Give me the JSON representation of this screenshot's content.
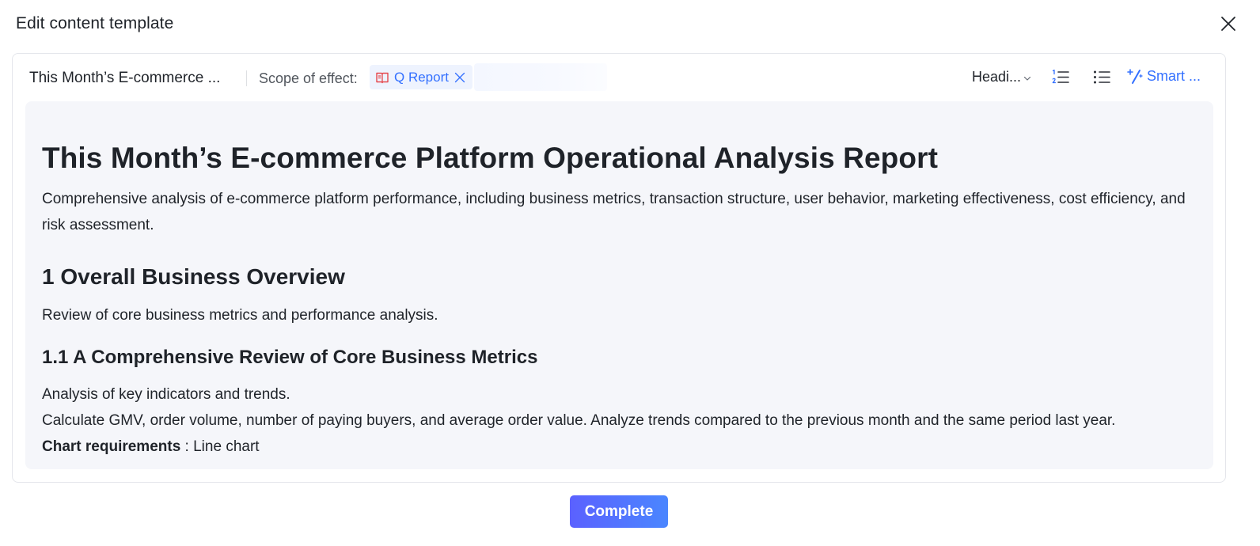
{
  "dialog": {
    "title": "Edit content template",
    "close_icon": "close-icon"
  },
  "toolbar": {
    "doc_name": "This Month’s E-commerce ...",
    "scope_label": "Scope of effect:",
    "scope_tag": {
      "label": "Q Report",
      "icon": "report-book-icon",
      "remove_icon": "close-icon"
    },
    "scope_input_placeholder": "",
    "heading_select": "Headi...",
    "ordered_list_icon": "ordered-list-icon",
    "bullet_list_icon": "bullet-list-icon",
    "smart_label": "Smart ...",
    "smart_icon": "magic-wand-icon"
  },
  "document": {
    "title": "This Month’s E-commerce Platform Operational Analysis Report",
    "intro": "Comprehensive analysis of e-commerce platform performance, including business metrics, transaction structure, user behavior, marketing effectiveness, cost efficiency, and risk assessment.",
    "section1": {
      "heading": "1 Overall Business Overview",
      "text": "Review of core business metrics and performance analysis."
    },
    "section1_1": {
      "heading": "1.1 A Comprehensive Review of Core Business Metrics",
      "line1": "Analysis of key indicators and trends.",
      "line2": "Calculate GMV, order volume, number of paying buyers, and average order value. Analyze trends compared to the previous month and the same period last year.",
      "chart_req_label": "Chart requirements",
      "chart_req_value": " : Line chart"
    }
  },
  "footer": {
    "complete_label": "Complete"
  },
  "colors": {
    "accent": "#3370ff",
    "content_bg": "#f5f6fa",
    "tag_bg": "#eef3fe",
    "report_icon": "#e5484d"
  }
}
